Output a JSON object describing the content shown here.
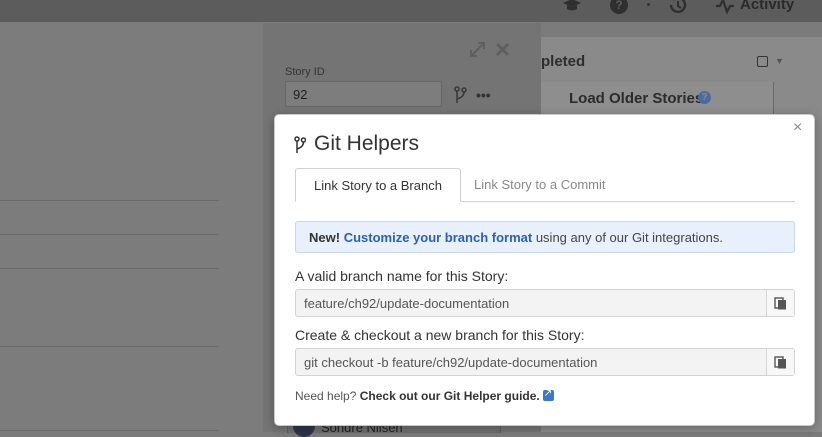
{
  "header": {
    "activity_label": "Activity",
    "icons": [
      "graduation-cap-icon",
      "help-icon",
      "history-icon",
      "activity-icon"
    ]
  },
  "completed_column": {
    "title": "pleted",
    "load_older_label": "Load Older Stories",
    "load_older_help": "?"
  },
  "story": {
    "id_label": "Story ID",
    "id_value": "92",
    "more_label": "•••",
    "owner_name": "Sondre Nilsen"
  },
  "git_helpers": {
    "title": "Git Helpers",
    "close_label": "×",
    "tabs": [
      {
        "label": "Link Story to a Branch",
        "active": true
      },
      {
        "label": "Link Story to a Commit",
        "active": false
      }
    ],
    "notice": {
      "new_label": "New!",
      "link_text": "Customize your branch format",
      "rest_text": " using any of our Git integrations."
    },
    "branch_name_label": "A valid branch name for this Story:",
    "branch_name_value": "feature/ch92/update-documentation",
    "checkout_label": "Create & checkout a new branch for this Story:",
    "checkout_value": "git checkout -b feature/ch92/update-documentation",
    "help_prefix": "Need help? ",
    "help_link": "Check out our Git Helper guide."
  },
  "colors": {
    "accent": "#2a61b0",
    "notice_bg": "#e8f0fb"
  }
}
